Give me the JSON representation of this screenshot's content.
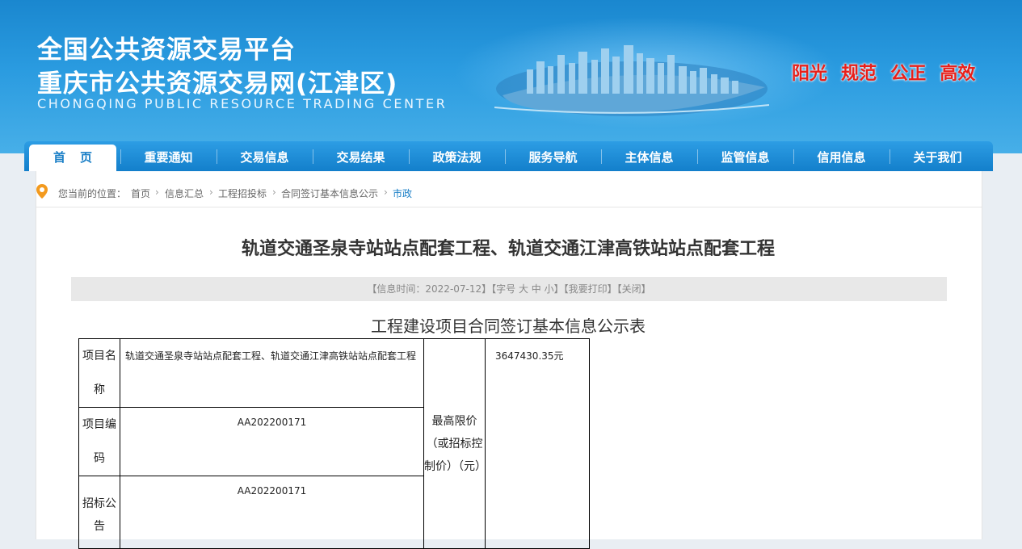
{
  "header": {
    "title_line1": "全国公共资源交易平台",
    "title_line2": "重庆市公共资源交易网(江津区)",
    "title_en": "CHONGQING PUBLIC RESOURCE TRADING CENTER",
    "slogans": [
      "阳光",
      "规范",
      "公正",
      "高效"
    ],
    "slogan_color": "#e8201a"
  },
  "nav": {
    "items": [
      "首页",
      "重要通知",
      "交易信息",
      "交易结果",
      "政策法规",
      "服务导航",
      "主体信息",
      "监管信息",
      "信用信息",
      "关于我们"
    ],
    "active_index": 0
  },
  "breadcrumb": {
    "prefix": "您当前的位置：",
    "items": [
      "首页",
      "信息汇总",
      "工程招投标",
      "合同签订基本信息公示",
      "市政"
    ]
  },
  "article": {
    "title": "轨道交通圣泉寺站站点配套工程、轨道交通江津高铁站站点配套工程",
    "info_bar": "【信息时间：2022-07-12】【字号 大 中 小】【我要打印】【关闭】",
    "table_title": "工程建设项目合同签订基本信息公示表"
  },
  "table": {
    "row1_label": "项目名称",
    "row1_value": "轨道交通圣泉寺站站点配套工程、轨道交通江津高铁站站点配套工程",
    "row2_label": "项目编码",
    "row2_value": "AA202200171",
    "row3_label": "招标公告",
    "row3_value": "AA202200171",
    "price_label": "最高限价（或招标控制价）（元）",
    "price_value": "3647430.35元"
  },
  "colors": {
    "accent": "#1a7fc7",
    "nav_bg": "#1f8fd7"
  }
}
